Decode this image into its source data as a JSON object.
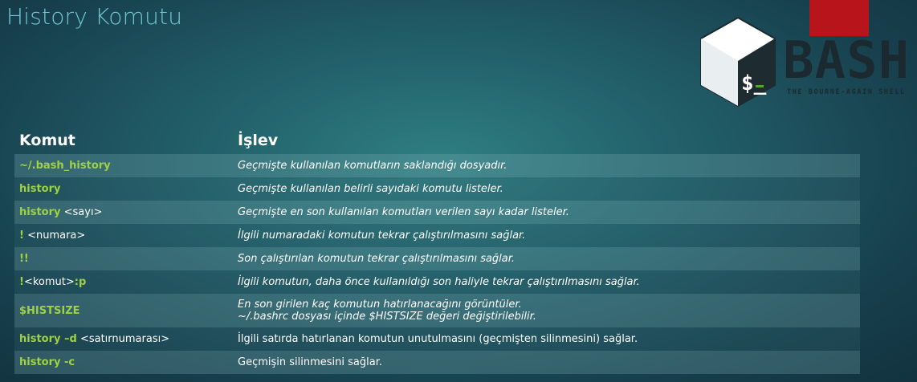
{
  "slide": {
    "title": "History Komutu"
  },
  "logo": {
    "prompt": "$_",
    "word": "BASH",
    "subtitle": "THE BOURNE-AGAIN SHELL",
    "accent_color": "#b8141b"
  },
  "table": {
    "headers": {
      "command": "Komut",
      "function": "İşlev"
    },
    "rows": [
      {
        "cmd": "~/.bash_history",
        "arg": "",
        "suffix": "",
        "func": [
          "Geçmişte kullanılan komutların saklandığı dosyadır."
        ],
        "italic": true
      },
      {
        "cmd": "history",
        "arg": "",
        "suffix": "",
        "func": [
          "Geçmişte kullanılan belirli sayıdaki komutu listeler."
        ],
        "italic": true
      },
      {
        "cmd": "history",
        "arg": " <sayı>",
        "suffix": "",
        "func": [
          "Geçmişte en son kullanılan komutları verilen sayı kadar listeler."
        ],
        "italic": true
      },
      {
        "cmd": "!",
        "arg": " <numara>",
        "suffix": "",
        "func": [
          "İlgili numaradaki komutun tekrar çalıştırılmasını sağlar."
        ],
        "italic": true
      },
      {
        "cmd": "!!",
        "arg": "",
        "suffix": "",
        "func": [
          "Son çalıştırılan komutun tekrar çalıştırılmasını sağlar."
        ],
        "italic": true
      },
      {
        "cmd": "!",
        "arg": "<komut>",
        "suffix": ":p",
        "func": [
          "İlgili komutun, daha önce kullanıldığı son haliyle tekrar çalıştırılmasını sağlar."
        ],
        "italic": true
      },
      {
        "cmd": "$HISTSIZE",
        "arg": "",
        "suffix": "",
        "func": [
          "En son girilen kaç komutun hatırlanacağını görüntüler.",
          "~/.bashrc dosyası içinde $HISTSIZE değeri değiştirilebilir."
        ],
        "italic": true
      },
      {
        "cmd": "history –d",
        "arg": " <satırnumarası>",
        "suffix": "",
        "func": [
          "İlgili satırda hatırlanan komutun unutulmasını (geçmişten silinmesini) sağlar."
        ],
        "italic": false
      },
      {
        "cmd": "history -c",
        "arg": "",
        "suffix": "",
        "func": [
          "Geçmişin silinmesini sağlar."
        ],
        "italic": false
      }
    ]
  }
}
